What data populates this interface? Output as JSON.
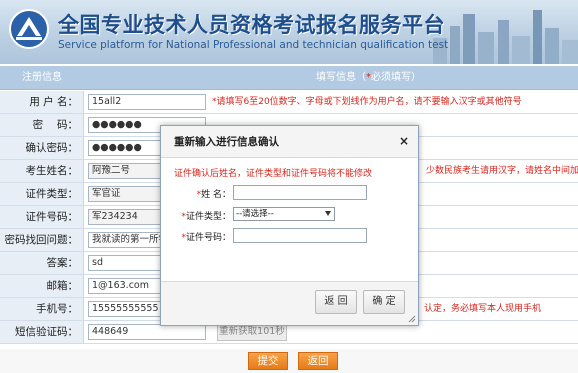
{
  "header": {
    "title_cn": "全国专业技术人员资格考试报名服务平台",
    "title_en": "Service platform for National Professional and technician  qualification test"
  },
  "form": {
    "left_header": "注册信息",
    "right_header_prefix": "填写信息（",
    "right_header_star": "*",
    "right_header_suffix": "必须填写）",
    "rows": [
      {
        "label": "用 户 名：",
        "value": "15all2",
        "hint": "*请填写6至20位数字、字母或下划线作为用户名，请不要输入汉字或其他符号"
      },
      {
        "label": "密　 码：",
        "value": "●●●●●●",
        "hint": ""
      },
      {
        "label": "确认密码：",
        "value": "●●●●●●",
        "hint": ""
      },
      {
        "label": "考生姓名：",
        "value": "阿豫二号",
        "hint": "少数民族考生请用汉字，请姓名中间加点"
      },
      {
        "label": "证件类型：",
        "value": "军官证",
        "hint": ""
      },
      {
        "label": "证件号码：",
        "value": "军234234",
        "hint": ""
      },
      {
        "label": "密码找回问题：",
        "value": "我就读的第一所学校",
        "hint": ""
      },
      {
        "label": "答案：",
        "value": "sd",
        "hint": ""
      },
      {
        "label": "邮箱：",
        "value": "1@163.com",
        "hint": ""
      },
      {
        "label": "手机号：",
        "value": "15555555555",
        "hint": "认定，务必填写本人现用手机"
      },
      {
        "label": "短信验证码：",
        "value": "448649",
        "hint": ""
      }
    ],
    "resend_label": "重新获取101秒",
    "submit_label": "提交",
    "back_label": "返回"
  },
  "modal": {
    "title": "重新输入进行信息确认",
    "close_glyph": "×",
    "warning": "证件确认后姓名，证件类型和证件号码将不能修改",
    "name_label": "姓 名：",
    "id_type_label": "证件类型：",
    "id_type_value": "--请选择--",
    "id_number_label": "证件号码：",
    "required_mark": "*",
    "back_button": "返 回",
    "confirm_button": "确 定"
  }
}
